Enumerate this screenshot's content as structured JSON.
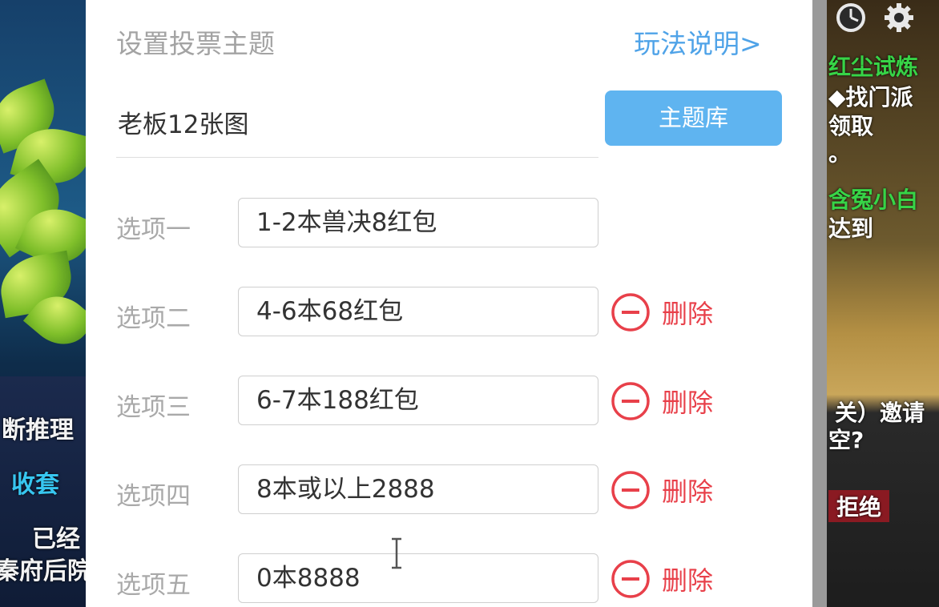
{
  "dialog": {
    "title": "设置投票主题",
    "help_link": "玩法说明>",
    "topic": "老板12张图",
    "library_button": "主题库",
    "options": [
      {
        "label": "选项一",
        "value": "1-2本兽决8红包",
        "deletable": false
      },
      {
        "label": "选项二",
        "value": "4-6本68红包",
        "deletable": true
      },
      {
        "label": "选项三",
        "value": "6-7本188红包",
        "deletable": true
      },
      {
        "label": "选项四",
        "value": "8本或以上2888",
        "deletable": true
      },
      {
        "label": "选项五",
        "value": "0本8888",
        "deletable": true
      }
    ],
    "delete_label": "删除"
  },
  "background_left": {
    "texts": [
      "断推理",
      "收套",
      "已经",
      "秦府后院"
    ]
  },
  "background_right": {
    "texts": [
      "红尘试炼",
      "◆找门派",
      "领取",
      "。",
      "含冤小白",
      "达到",
      "关）邀请",
      "空?",
      "拒绝"
    ]
  },
  "colors": {
    "accent": "#4fa3e8",
    "button": "#5fb4f0",
    "danger": "#e8404a",
    "label": "#a9a9a9"
  }
}
